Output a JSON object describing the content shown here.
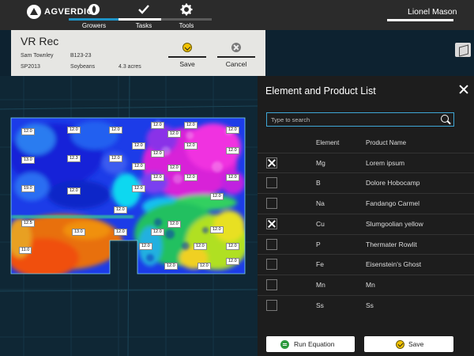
{
  "app": {
    "logo_text": "AGVERDICT",
    "logo_icon": "agverdict-logo-icon",
    "user_name": "Lionel Mason"
  },
  "nav": {
    "tabs": [
      {
        "label": "Growers",
        "icon": "grower-icon",
        "state": "active"
      },
      {
        "label": "Tasks",
        "icon": "checkmark-icon",
        "state": "normal"
      },
      {
        "label": "Tools",
        "icon": "gear-icon",
        "state": "normal"
      }
    ]
  },
  "rec": {
    "title": "VR Rec",
    "grower": "Sam Townley",
    "field_id": "B123-23",
    "season": "SP2013",
    "crop": "Soybeans",
    "area": "4.3 acres",
    "save_label": "Save",
    "cancel_label": "Cancel"
  },
  "map": {
    "zone_labels": [
      "12.0",
      "12.0",
      "12.0",
      "12.0",
      "12.0",
      "12.0",
      "12.0",
      "12.0",
      "12.0",
      "13.0",
      "12.3",
      "12.0",
      "12.0",
      "12.0",
      "12.0",
      "12.0",
      "12.0",
      "12.0",
      "19.0",
      "12.0",
      "12.0",
      "12.0",
      "12.0",
      "12.0",
      "12.5",
      "13.0",
      "12.0",
      "12.0",
      "12.0",
      "12.0",
      "11.0",
      "12.0",
      "12.0",
      "12.0",
      "12.0",
      "12.0",
      "12.0"
    ]
  },
  "panel": {
    "title": "Element and Product List",
    "search_placeholder": "Type to search",
    "col_element": "Element",
    "col_product": "Product Name",
    "rows": [
      {
        "element": "Mg",
        "product": "Lorem ipsum",
        "checked": true
      },
      {
        "element": "B",
        "product": "Dolore Hobocamp",
        "checked": false
      },
      {
        "element": "Na",
        "product": "Fandango Carmel",
        "checked": false
      },
      {
        "element": "Cu",
        "product": "Slumgoolian yellow",
        "checked": true
      },
      {
        "element": "P",
        "product": "Thermater Rowlit",
        "checked": false
      },
      {
        "element": "Fe",
        "product": "Eisenstein's Ghost",
        "checked": false
      },
      {
        "element": "Mn",
        "product": "Mn",
        "checked": false
      },
      {
        "element": "Ss",
        "product": "Ss",
        "checked": false
      }
    ],
    "run_equation_label": "Run Equation",
    "save_label": "Save"
  },
  "colors": {
    "topbar": "#2b2b2b",
    "accent_blue": "#1e93c6",
    "panel_bg": "#1d1d1d",
    "save_yellow": "#f3c300",
    "run_green": "#2e9a3e"
  }
}
